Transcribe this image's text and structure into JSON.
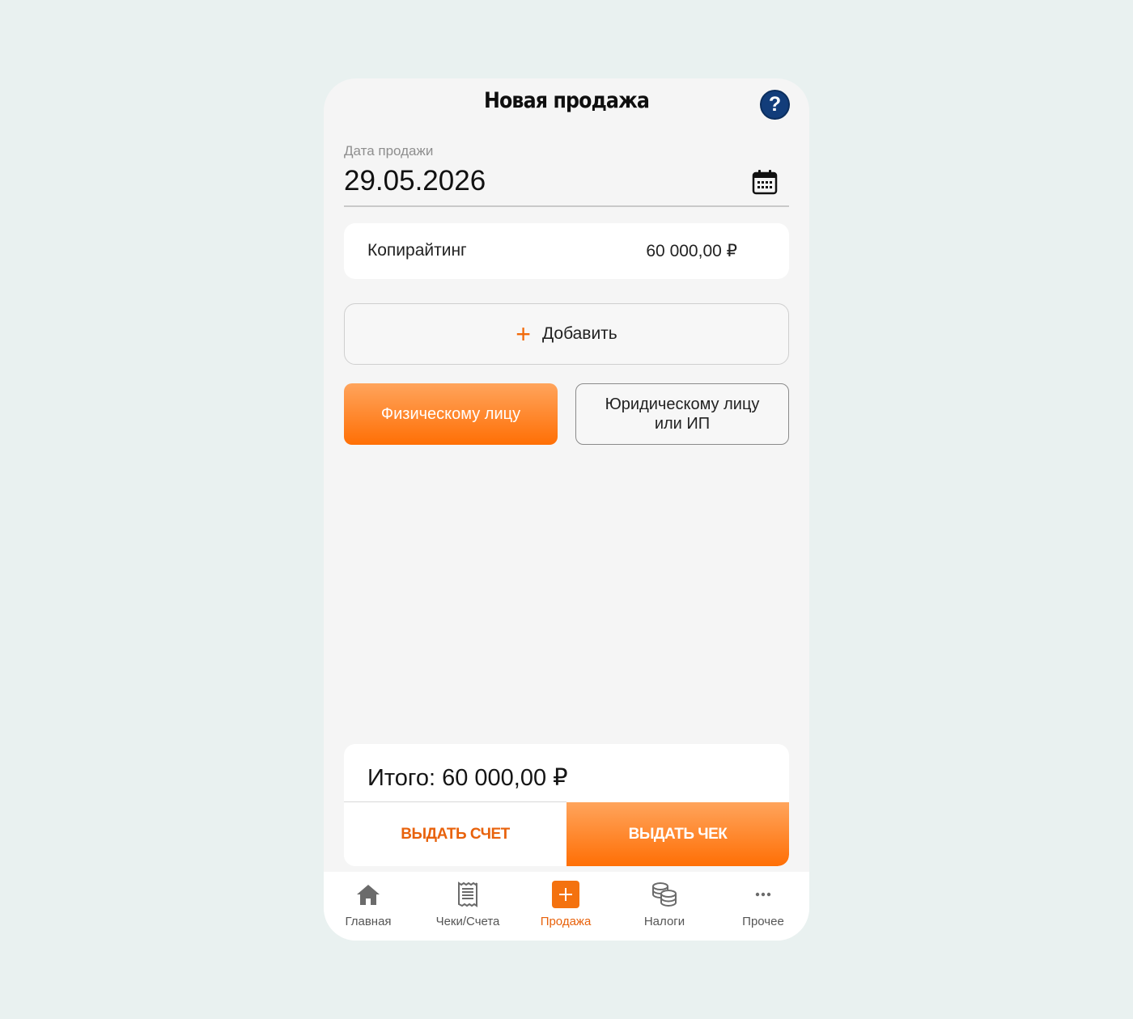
{
  "header": {
    "title": "Новая продажа",
    "help_icon": "?"
  },
  "date": {
    "label": "Дата продажи",
    "value": "29.05.2026"
  },
  "items": [
    {
      "name": "Копирайтинг",
      "price": "60 000,00 ₽"
    }
  ],
  "add_button": {
    "icon": "+",
    "label": "Добавить"
  },
  "buyer": {
    "individual": "Физическому лицу",
    "legal": "Юридическому лицу или ИП",
    "selected": "individual"
  },
  "total": {
    "text": "Итого: 60 000,00 ₽"
  },
  "actions": {
    "invoice": "ВЫДАТЬ СЧЕТ",
    "receipt": "ВЫДАТЬ ЧЕК"
  },
  "tabs": [
    {
      "label": "Главная",
      "icon": "home-icon"
    },
    {
      "label": "Чеки/Счета",
      "icon": "receipt-icon"
    },
    {
      "label": "Продажа",
      "icon": "plus-icon",
      "active": true
    },
    {
      "label": "Налоги",
      "icon": "coins-icon"
    },
    {
      "label": "Прочее",
      "icon": "more-icon"
    }
  ],
  "colors": {
    "accent": "#ff6f05",
    "help": "#123d7a",
    "background": "#e9f1f0"
  }
}
